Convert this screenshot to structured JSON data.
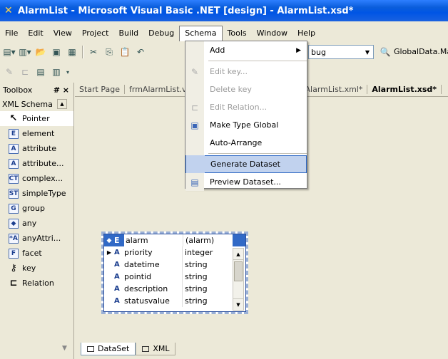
{
  "window": {
    "title": "AlarmList - Microsoft Visual Basic .NET [design] - AlarmList.xsd*"
  },
  "menubar": [
    "File",
    "Edit",
    "View",
    "Project",
    "Build",
    "Debug",
    "Schema",
    "Tools",
    "Window",
    "Help"
  ],
  "toolbar": {
    "config_combo": "bug",
    "project_combo": "GlobalData.Main"
  },
  "toolbox": {
    "header": "Toolbox",
    "pin": "# ×",
    "tab": "XML Schema",
    "items": [
      {
        "icon": "pointer-icon",
        "glyph": "↖",
        "label": "Pointer"
      },
      {
        "icon": "element-icon",
        "glyph": "E",
        "label": "element"
      },
      {
        "icon": "attribute-icon",
        "glyph": "A",
        "label": "attribute"
      },
      {
        "icon": "attribute-group-icon",
        "glyph": "A",
        "label": "attribute..."
      },
      {
        "icon": "complex-type-icon",
        "glyph": "CT",
        "label": "complex..."
      },
      {
        "icon": "simple-type-icon",
        "glyph": "ST",
        "label": "simpleType"
      },
      {
        "icon": "group-icon",
        "glyph": "G",
        "label": "group"
      },
      {
        "icon": "any-icon",
        "glyph": "◆",
        "label": "any"
      },
      {
        "icon": "any-attribute-icon",
        "glyph": "*A",
        "label": "anyAttri..."
      },
      {
        "icon": "facet-icon",
        "glyph": "F",
        "label": "facet"
      },
      {
        "icon": "key-icon",
        "glyph": "⚷",
        "label": "key"
      },
      {
        "icon": "relation-icon",
        "glyph": "⊏",
        "label": "Relation"
      }
    ]
  },
  "doc_tabs": [
    "Start Page",
    "frmAlarmList.vb",
    "AlarmList.xml*",
    "AlarmList.xsd*"
  ],
  "schema_menu": [
    {
      "label": "Add",
      "disabled": false,
      "submenu": true,
      "icon": ""
    },
    {
      "separator": true
    },
    {
      "label": "Edit key...",
      "disabled": true,
      "icon": "key-edit-icon"
    },
    {
      "label": "Delete key",
      "disabled": true,
      "icon": ""
    },
    {
      "label": "Edit Relation...",
      "disabled": true,
      "icon": "relation-edit-icon"
    },
    {
      "label": "Make Type Global",
      "disabled": false,
      "icon": "make-global-icon"
    },
    {
      "label": "Auto-Arrange",
      "disabled": false,
      "icon": ""
    },
    {
      "separator": true
    },
    {
      "label": "Generate Dataset",
      "disabled": false,
      "highlighted": true,
      "icon": ""
    },
    {
      "label": "Preview Dataset...",
      "disabled": false,
      "icon": "preview-dataset-icon"
    }
  ],
  "element": {
    "kind": "E",
    "name": "alarm",
    "type": "(alarm)",
    "rows": [
      {
        "kind": "A",
        "name": "priority",
        "type": "integer"
      },
      {
        "kind": "A",
        "name": "datetime",
        "type": "string"
      },
      {
        "kind": "A",
        "name": "pointid",
        "type": "string"
      },
      {
        "kind": "A",
        "name": "description",
        "type": "string"
      },
      {
        "kind": "A",
        "name": "statusvalue",
        "type": "string"
      }
    ]
  },
  "bottom_tabs": [
    "DataSet",
    "XML"
  ]
}
